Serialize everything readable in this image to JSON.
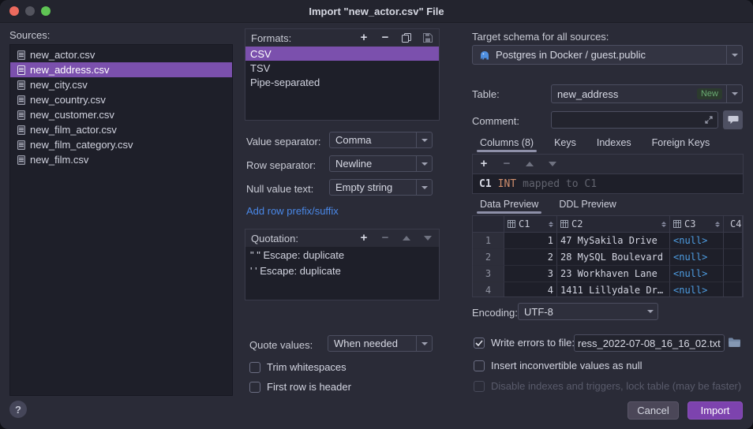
{
  "window": {
    "title": "Import \"new_actor.csv\" File"
  },
  "sources": {
    "label": "Sources:",
    "items": [
      "new_actor.csv",
      "new_address.csv",
      "new_city.csv",
      "new_country.csv",
      "new_customer.csv",
      "new_film_actor.csv",
      "new_film_category.csv",
      "new_film.csv"
    ]
  },
  "formats": {
    "label": "Formats:",
    "items": [
      "CSV",
      "TSV",
      "Pipe-separated"
    ]
  },
  "fields": {
    "value_separator": {
      "label": "Value separator:",
      "value": "Comma"
    },
    "row_separator": {
      "label": "Row separator:",
      "value": "Newline"
    },
    "null_value_text": {
      "label": "Null value text:",
      "value": "Empty string"
    },
    "quote_values": {
      "label": "Quote values:",
      "value": "When needed"
    },
    "encoding": {
      "label": "Encoding:",
      "value": "UTF-8"
    }
  },
  "links": {
    "add_row": "Add row prefix/suffix"
  },
  "quotation": {
    "label": "Quotation:",
    "items": [
      "\" \"  Escape: duplicate",
      "' '  Escape: duplicate"
    ]
  },
  "checkboxes": {
    "trim": {
      "label": "Trim whitespaces",
      "checked": false
    },
    "first_row": {
      "label": "First row is header",
      "checked": false
    },
    "write_errors": {
      "label": "Write errors to file:",
      "checked": true,
      "value": "ress_2022-07-08_16_16_02.txt"
    },
    "insert_null": {
      "label": "Insert inconvertible values as null",
      "checked": false
    },
    "disable_indexes": {
      "label": "Disable indexes and triggers, lock table (may be faster)",
      "checked": false
    }
  },
  "target": {
    "label": "Target schema for all sources:",
    "value": "Postgres in Docker / guest.public"
  },
  "table": {
    "label": "Table:",
    "value": "new_address",
    "badge": "New"
  },
  "comment": {
    "label": "Comment:",
    "value": ""
  },
  "struct_tabs": {
    "columns": "Columns (8)",
    "keys": "Keys",
    "indexes": "Indexes",
    "foreign_keys": "Foreign Keys"
  },
  "column_def": {
    "name": "C1",
    "type": "INT",
    "mapping": "mapped to C1"
  },
  "preview_tabs": {
    "data": "Data Preview",
    "ddl": "DDL Preview"
  },
  "preview": {
    "columns": [
      "C1",
      "C2",
      "C3",
      "C4"
    ],
    "rows": [
      {
        "n": "1",
        "c1": "1",
        "c2": "47 MySakila Drive",
        "c3": "<null>"
      },
      {
        "n": "2",
        "c1": "2",
        "c2": "28 MySQL Boulevard",
        "c3": "<null>"
      },
      {
        "n": "3",
        "c1": "3",
        "c2": "23 Workhaven Lane",
        "c3": "<null>"
      },
      {
        "n": "4",
        "c1": "4",
        "c2": "1411 Lillydale Dr…",
        "c3": "<null>"
      }
    ]
  },
  "footer": {
    "help": "?",
    "cancel": "Cancel",
    "import": "Import"
  },
  "colors": {
    "accent": "#7b50ad",
    "import_button": "#7d43ae",
    "link": "#4a88e8",
    "null_value": "#4e9ee3",
    "type_orange": "#cf8e6d",
    "new_badge": "#6aab73"
  }
}
